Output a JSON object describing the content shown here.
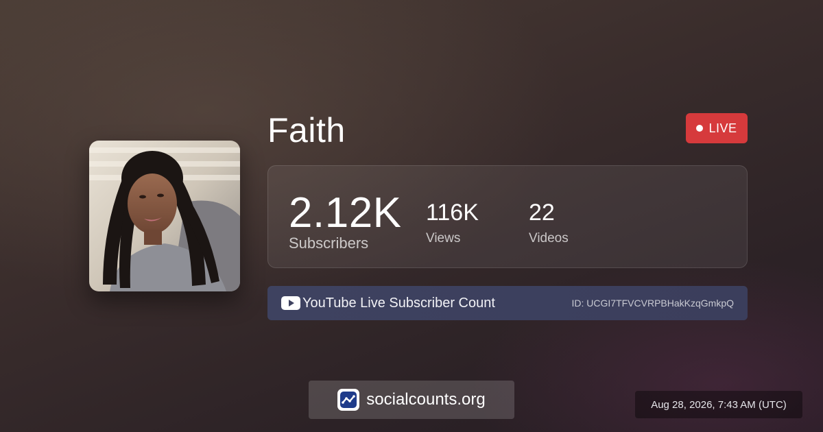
{
  "channel": {
    "name": "Faith",
    "avatar_alt": "Faith"
  },
  "live_badge": {
    "label": "LIVE",
    "color": "#d63a3c"
  },
  "stats": {
    "subscribers": {
      "value": "2.12K",
      "label": "Subscribers"
    },
    "views": {
      "value": "116K",
      "label": "Views"
    },
    "videos": {
      "value": "22",
      "label": "Videos"
    }
  },
  "info_bar": {
    "icon": "youtube-play-icon",
    "title": "YouTube Live Subscriber Count",
    "channel_id": "ID: UCGI7TFVCVRPBHakKzqGmkpQ"
  },
  "brand": {
    "icon": "socialcounts-logo-icon",
    "text": "socialcounts.org",
    "accent": "#1f3b8a"
  },
  "timestamp": "Aug 28, 2026, 7:43 AM (UTC)"
}
